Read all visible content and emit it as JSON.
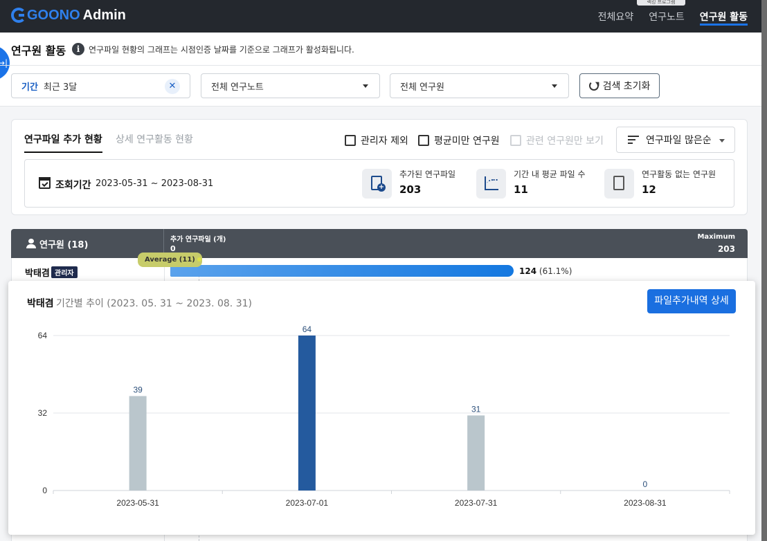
{
  "app": {
    "logo_brand": "GOONO",
    "logo_suffix": "Admin",
    "nav": [
      "전체요약",
      "연구노트",
      "연구원 활동"
    ],
    "active_nav": "연구원 활동",
    "tooltip_fragment": "랙킹 프로그램"
  },
  "page": {
    "title": "연구원 활동",
    "description": "연구파일 현황의 그래프는 시점인증 날짜를 기준으로 그래프가 활성화됩니다."
  },
  "filters": {
    "period_label": "기간",
    "period_value": "최근 3달",
    "note_select": "전체 연구노트",
    "researcher_select": "전체 연구원",
    "reset_label": "검색 초기화"
  },
  "card": {
    "tabs": [
      "연구파일 추가 현황",
      "상세 연구활동 현황"
    ],
    "checkboxes": [
      "관리자 제외",
      "평균미만 연구원",
      "관련 연구원만 보기"
    ],
    "sort_label": "연구파일 많은순",
    "period_title": "조회기간",
    "period_range": "2023-05-31 ~ 2023-08-31",
    "stats": [
      {
        "title": "추가된 연구파일",
        "value": "203",
        "icon": "file-add-icon"
      },
      {
        "title": "기간 내 평균 파일 수",
        "value": "11",
        "icon": "chart-trend-icon"
      },
      {
        "title": "연구활동 없는 연구원",
        "value": "12",
        "icon": "file-empty-icon"
      }
    ]
  },
  "table": {
    "researcher_header": "연구원 (18)",
    "files_header": "추가 연구파일 (개)",
    "min_label": "0",
    "max_label": "Maximum",
    "max_value": "203",
    "average_tag": "Average (11)",
    "rows": [
      {
        "name": "박태겸",
        "badge": "관리자",
        "count": "124",
        "percent": "(61.1%)",
        "fraction": 0.611
      }
    ]
  },
  "popup": {
    "name": "박태겸",
    "subtitle": "기간별 추이 (2023. 05. 31 ~ 2023. 08. 31)",
    "detail_button": "파일추가내역 상세"
  },
  "chart_data": {
    "type": "bar",
    "categories": [
      "2023-05-31",
      "2023-07-01",
      "2023-07-31",
      "2023-08-31"
    ],
    "values": [
      39,
      64,
      31,
      0
    ],
    "highlight_index": 1,
    "yticks": [
      0,
      32,
      64
    ],
    "ylim": [
      0,
      64
    ],
    "colors": {
      "default": "#bac6cc",
      "highlight": "#245a9e"
    },
    "title": "",
    "xlabel": "",
    "ylabel": "",
    "grid": true
  }
}
